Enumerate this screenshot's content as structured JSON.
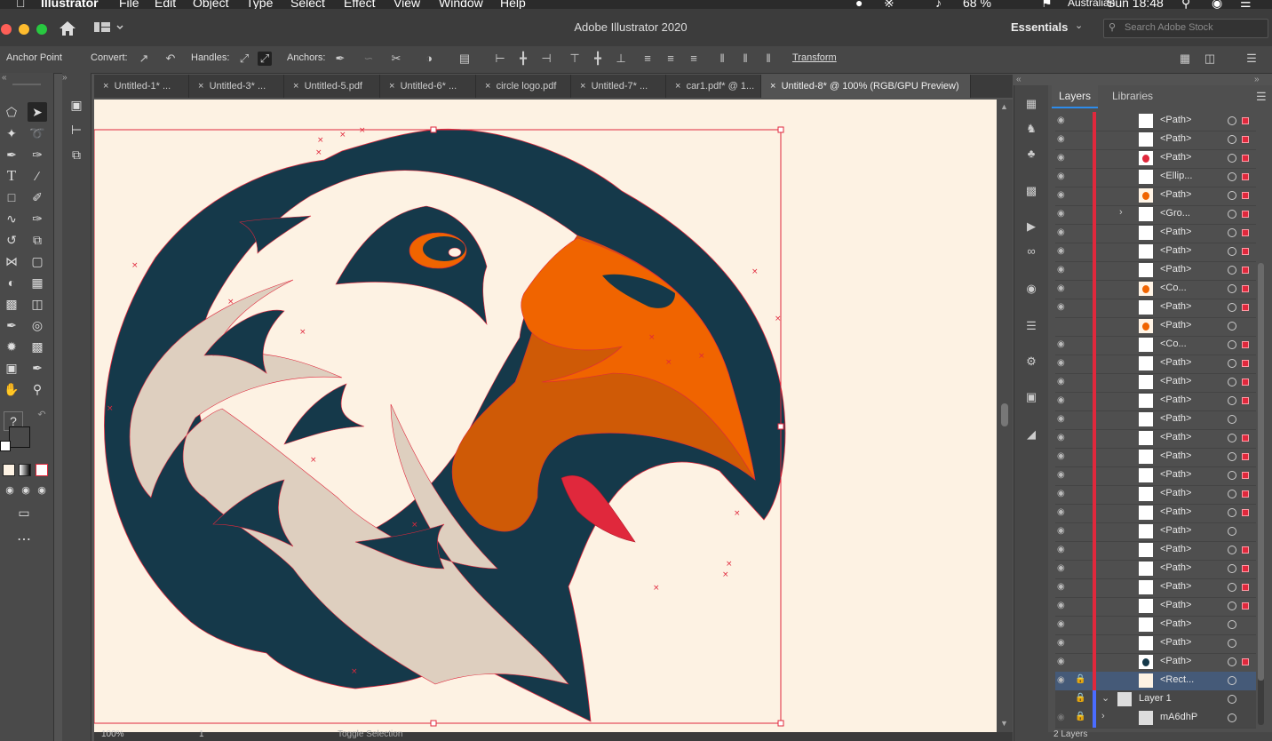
{
  "menubar": {
    "app": "Illustrator",
    "items": [
      "File",
      "Edit",
      "Object",
      "Type",
      "Select",
      "Effect",
      "View",
      "Window",
      "Help"
    ],
    "battery": "68 %",
    "input_source": "Australian",
    "clock": "Sun 18:48"
  },
  "window": {
    "title": "Adobe Illustrator 2020",
    "workspace": "Essentials",
    "search_placeholder": "Search Adobe Stock"
  },
  "controlbar": {
    "tool_name": "Anchor Point",
    "convert_label": "Convert:",
    "handles_label": "Handles:",
    "anchors_label": "Anchors:",
    "transform_label": "Transform"
  },
  "tabs": [
    {
      "label": "Untitled-1* ...",
      "active": false
    },
    {
      "label": "Untitled-3* ...",
      "active": false
    },
    {
      "label": "Untitled-5.pdf",
      "active": false
    },
    {
      "label": "Untitled-6* ...",
      "active": false
    },
    {
      "label": "circle logo.pdf",
      "active": false
    },
    {
      "label": "Untitled-7* ...",
      "active": false
    },
    {
      "label": "car1.pdf* @ 1...",
      "active": false
    },
    {
      "label": "Untitled-8* @ 100% (RGB/GPU Preview)",
      "active": true
    }
  ],
  "panel": {
    "tab_layers": "Layers",
    "tab_libraries": "Libraries",
    "footer": "2 Layers"
  },
  "layers": [
    {
      "name": "<Path>",
      "swatch": "white",
      "visible": true,
      "selected": true
    },
    {
      "name": "<Path>",
      "swatch": "white",
      "visible": true,
      "selected": true
    },
    {
      "name": "<Path>",
      "swatch": "red",
      "visible": true,
      "selected": true
    },
    {
      "name": "<Ellip...",
      "swatch": "white",
      "visible": true,
      "selected": true
    },
    {
      "name": "<Path>",
      "swatch": "orange",
      "visible": true,
      "selected": true
    },
    {
      "name": "<Gro...",
      "swatch": "white",
      "visible": true,
      "selected": true
    },
    {
      "name": "<Path>",
      "swatch": "white",
      "visible": true,
      "selected": true
    },
    {
      "name": "<Path>",
      "swatch": "white",
      "visible": true,
      "selected": true
    },
    {
      "name": "<Path>",
      "swatch": "white",
      "visible": true,
      "selected": true
    },
    {
      "name": "<Co...",
      "swatch": "orange",
      "visible": true,
      "selected": true
    },
    {
      "name": "<Path>",
      "swatch": "white",
      "visible": true,
      "selected": true
    },
    {
      "name": "<Path>",
      "swatch": "orange",
      "visible": false,
      "selected": false
    },
    {
      "name": "<Co...",
      "swatch": "white",
      "visible": true,
      "selected": true
    },
    {
      "name": "<Path>",
      "swatch": "white",
      "visible": true,
      "selected": true
    },
    {
      "name": "<Path>",
      "swatch": "white",
      "visible": true,
      "selected": true
    },
    {
      "name": "<Path>",
      "swatch": "white",
      "visible": true,
      "selected": true
    },
    {
      "name": "<Path>",
      "swatch": "white",
      "visible": true,
      "selected": false
    },
    {
      "name": "<Path>",
      "swatch": "white",
      "visible": true,
      "selected": true
    },
    {
      "name": "<Path>",
      "swatch": "white",
      "visible": true,
      "selected": true
    },
    {
      "name": "<Path>",
      "swatch": "white",
      "visible": true,
      "selected": true
    },
    {
      "name": "<Path>",
      "swatch": "white",
      "visible": true,
      "selected": true
    },
    {
      "name": "<Path>",
      "swatch": "white",
      "visible": true,
      "selected": true
    },
    {
      "name": "<Path>",
      "swatch": "white",
      "visible": true,
      "selected": false
    },
    {
      "name": "<Path>",
      "swatch": "white",
      "visible": true,
      "selected": true
    },
    {
      "name": "<Path>",
      "swatch": "white",
      "visible": true,
      "selected": true
    },
    {
      "name": "<Path>",
      "swatch": "white",
      "visible": true,
      "selected": true
    },
    {
      "name": "<Path>",
      "swatch": "white",
      "visible": true,
      "selected": true
    },
    {
      "name": "<Path>",
      "swatch": "white",
      "visible": true,
      "selected": false
    },
    {
      "name": "<Path>",
      "swatch": "white",
      "visible": true,
      "selected": false
    },
    {
      "name": "<Path>",
      "swatch": "navy",
      "visible": true,
      "selected": true
    },
    {
      "name": "<Rect...",
      "swatch": "cream",
      "visible": true,
      "selected": false,
      "locked": true,
      "active": true
    }
  ],
  "layer_groups": [
    {
      "name": "Layer 1"
    },
    {
      "name": "mA6dhP"
    }
  ],
  "status": {
    "zoom": "100%",
    "artboard": "1",
    "mode": "Toggle Selection"
  },
  "colors": {
    "navy": "#15394a",
    "orange": "#f06400",
    "dark_orange": "#cf5a06",
    "cream": "#fdf2e3",
    "feather": "#decfbf",
    "selection": "#e0283c"
  }
}
